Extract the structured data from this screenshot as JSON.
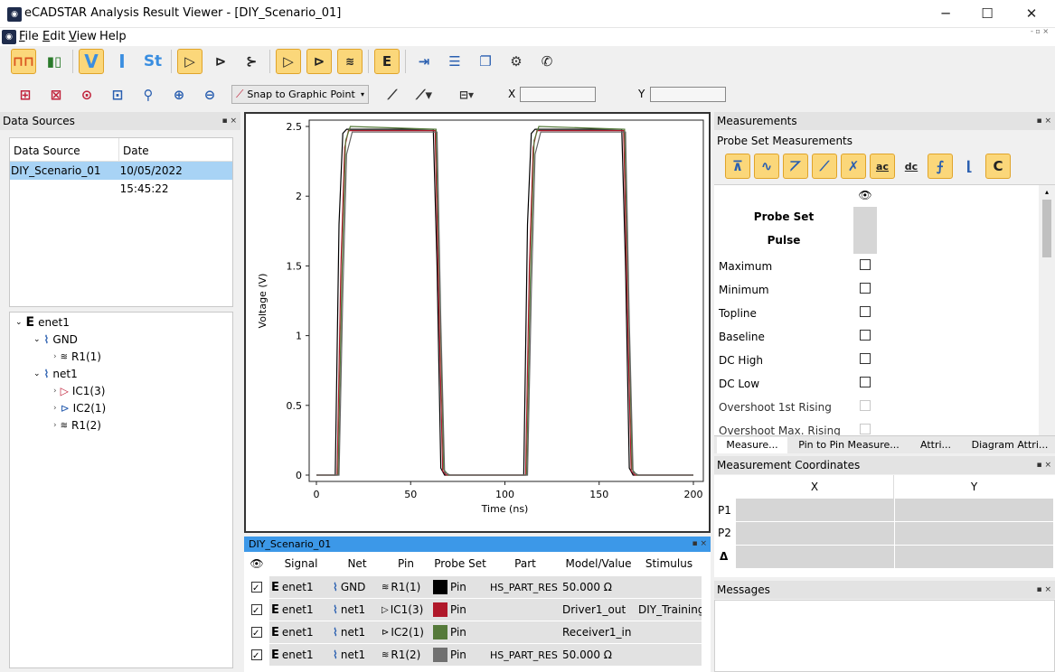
{
  "window": {
    "title": "eCADSTAR Analysis Result Viewer - [DIY_Scenario_01]",
    "app_icon": "ecadstar-app-icon"
  },
  "menu": {
    "items": [
      {
        "hot": "F",
        "rest": "ile"
      },
      {
        "hot": "E",
        "rest": "dit"
      },
      {
        "hot": "V",
        "rest": "iew"
      },
      {
        "hot": "",
        "rest": "Help"
      }
    ]
  },
  "toolbar2": {
    "snap_label": "Snap to Graphic Point",
    "x_label": "X",
    "y_label": "Y",
    "x_value": "",
    "y_value": ""
  },
  "data_sources": {
    "title": "Data Sources",
    "columns": [
      "Data Source",
      "Date"
    ],
    "rows": [
      {
        "source": "DIY_Scenario_01",
        "date": "10/05/2022 15:45:22"
      }
    ]
  },
  "tree": {
    "root": "enet1",
    "gnd": "GND",
    "gnd_child": "R1(1)",
    "net1": "net1",
    "net1_children": [
      "IC1(3)",
      "IC2(1)",
      "R1(2)"
    ]
  },
  "chart_data": {
    "type": "line",
    "title": "",
    "xlabel": "Time (ns)",
    "ylabel": "Voltage (V)",
    "xlim": [
      0,
      200
    ],
    "ylim": [
      0,
      2.5
    ],
    "x_ticks": [
      "0",
      "50",
      "100",
      "150",
      "200"
    ],
    "y_ticks": [
      "0",
      "0.5",
      "1",
      "1.5",
      "2",
      "2.5"
    ],
    "grid": false,
    "series": [
      {
        "color": "#000000",
        "x": [
          0,
          10,
          12,
          14,
          16,
          62,
          64,
          66,
          68,
          110,
          112,
          114,
          116,
          162,
          164,
          166,
          168,
          200
        ],
        "y": [
          0,
          0,
          1.8,
          2.45,
          2.48,
          2.48,
          1.5,
          0.05,
          0,
          0,
          1.8,
          2.45,
          2.48,
          2.48,
          1.5,
          0.05,
          0,
          0
        ]
      },
      {
        "color": "#b0182a",
        "x": [
          0,
          11,
          13,
          15,
          17,
          63,
          65,
          67,
          69,
          111,
          113,
          115,
          117,
          163,
          165,
          167,
          169,
          200
        ],
        "y": [
          0,
          0,
          1.5,
          2.35,
          2.47,
          2.47,
          1.2,
          0.03,
          0,
          0,
          1.5,
          2.35,
          2.47,
          2.47,
          1.2,
          0.03,
          0,
          0
        ]
      },
      {
        "color": "#557a3a",
        "x": [
          0,
          11.5,
          13.5,
          15.5,
          18,
          63.5,
          65.5,
          67.5,
          70,
          111.5,
          113.5,
          115.5,
          118,
          163.5,
          165.5,
          167.5,
          170,
          200
        ],
        "y": [
          0,
          0,
          1.4,
          2.4,
          2.5,
          2.48,
          1.3,
          0.04,
          0,
          0,
          1.4,
          2.4,
          2.5,
          2.48,
          1.3,
          0.04,
          0,
          0
        ]
      },
      {
        "color": "#666666",
        "x": [
          0,
          12,
          14,
          16,
          19,
          64,
          66,
          68,
          71,
          112,
          114,
          116,
          119,
          164,
          166,
          168,
          171,
          200
        ],
        "y": [
          0,
          0,
          1.3,
          2.3,
          2.46,
          2.46,
          1.1,
          0.02,
          0,
          0,
          1.3,
          2.3,
          2.46,
          2.46,
          1.1,
          0.02,
          0,
          0
        ]
      }
    ]
  },
  "signals_panel": {
    "title": "DIY_Scenario_01",
    "columns": [
      "Signal",
      "Net",
      "Pin",
      "Probe Set",
      "Part",
      "Model/Value",
      "Stimulus"
    ],
    "rows": [
      {
        "signal": "enet1",
        "net": "GND",
        "pin": "R1(1)",
        "pin_icon": "resistor-icon",
        "color": "#000000",
        "probe": "Pin",
        "part": "HS_PART_RES",
        "model": "50.000 Ω",
        "stimulus": ""
      },
      {
        "signal": "enet1",
        "net": "net1",
        "pin": "IC1(3)",
        "pin_icon": "driver-icon",
        "color": "#b0182a",
        "probe": "Pin",
        "part": "",
        "model": "Driver1_out",
        "stimulus": "DIY_Training"
      },
      {
        "signal": "enet1",
        "net": "net1",
        "pin": "IC2(1)",
        "pin_icon": "receiver-icon",
        "color": "#557a3a",
        "probe": "Pin",
        "part": "",
        "model": "Receiver1_in",
        "stimulus": ""
      },
      {
        "signal": "enet1",
        "net": "net1",
        "pin": "R1(2)",
        "pin_icon": "resistor-icon",
        "color": "#707070",
        "probe": "Pin",
        "part": "HS_PART_RES",
        "model": "50.000 Ω",
        "stimulus": ""
      }
    ]
  },
  "measurements": {
    "title": "Measurements",
    "sub_title": "Probe Set Measurements",
    "probe_set_label": "Probe Set",
    "pulse_label": "Pulse",
    "items": [
      {
        "label": "Maximum",
        "enabled": true
      },
      {
        "label": "Minimum",
        "enabled": true
      },
      {
        "label": "Topline",
        "enabled": true
      },
      {
        "label": "Baseline",
        "enabled": true
      },
      {
        "label": "DC High",
        "enabled": true
      },
      {
        "label": "DC Low",
        "enabled": true
      },
      {
        "label": "Overshoot 1st Rising",
        "enabled": false
      },
      {
        "label": "Overshoot Max. Rising",
        "enabled": false
      }
    ],
    "tabs": [
      "Measure...",
      "Pin to Pin Measure...",
      "Attri...",
      "Diagram Attri..."
    ]
  },
  "coordinates": {
    "title": "Measurement Coordinates",
    "columns": [
      "X",
      "Y"
    ],
    "rows": [
      "P1",
      "P2",
      "Δ"
    ]
  },
  "messages": {
    "title": "Messages"
  }
}
